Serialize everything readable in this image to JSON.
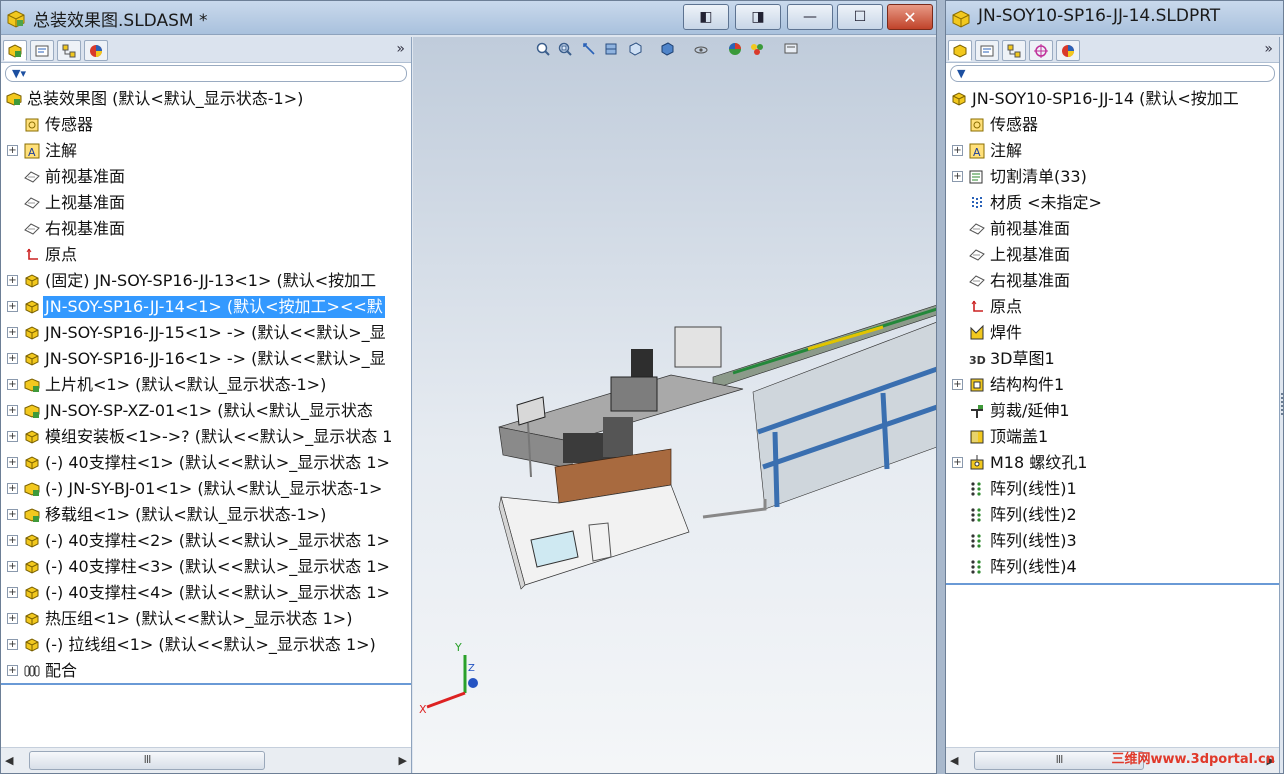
{
  "left_window": {
    "title": "总装效果图.SLDASM *",
    "tree": [
      {
        "label": "总装效果图  (默认<默认_显示状态-1>)",
        "icon": "assembly-icon",
        "level": 0,
        "expander": ""
      },
      {
        "label": "传感器",
        "icon": "sensor-icon",
        "level": 1,
        "expander": ""
      },
      {
        "label": "注解",
        "icon": "annotation-icon",
        "level": 1,
        "expander": "+"
      },
      {
        "label": "前视基准面",
        "icon": "plane-icon",
        "level": 1,
        "expander": ""
      },
      {
        "label": "上视基准面",
        "icon": "plane-icon",
        "level": 1,
        "expander": ""
      },
      {
        "label": "右视基准面",
        "icon": "plane-icon",
        "level": 1,
        "expander": ""
      },
      {
        "label": "原点",
        "icon": "origin-icon",
        "level": 1,
        "expander": ""
      },
      {
        "label": "(固定) JN-SOY-SP16-JJ-13<1> (默认<按加工",
        "icon": "component-icon",
        "level": 1,
        "expander": "+"
      },
      {
        "label": "JN-SOY-SP16-JJ-14<1> (默认<按加工><<默",
        "icon": "component-icon",
        "level": 1,
        "expander": "+",
        "selected": true
      },
      {
        "label": "JN-SOY-SP16-JJ-15<1> -> (默认<<默认>_显",
        "icon": "component-icon",
        "level": 1,
        "expander": "+"
      },
      {
        "label": "JN-SOY-SP16-JJ-16<1> -> (默认<<默认>_显",
        "icon": "component-icon",
        "level": 1,
        "expander": "+"
      },
      {
        "label": "上片机<1> (默认<默认_显示状态-1>)",
        "icon": "subassembly-icon",
        "level": 1,
        "expander": "+"
      },
      {
        "label": "JN-SOY-SP-XZ-01<1> (默认<默认_显示状态",
        "icon": "subassembly-icon",
        "level": 1,
        "expander": "+"
      },
      {
        "label": "模组安装板<1>->? (默认<<默认>_显示状态 1",
        "icon": "component-icon",
        "level": 1,
        "expander": "+"
      },
      {
        "label": "(-) 40支撑柱<1> (默认<<默认>_显示状态 1>",
        "icon": "component-icon",
        "level": 1,
        "expander": "+"
      },
      {
        "label": "(-) JN-SY-BJ-01<1> (默认<默认_显示状态-1>",
        "icon": "subassembly-icon",
        "level": 1,
        "expander": "+"
      },
      {
        "label": "移载组<1> (默认<默认_显示状态-1>)",
        "icon": "subassembly-icon",
        "level": 1,
        "expander": "+"
      },
      {
        "label": "(-) 40支撑柱<2> (默认<<默认>_显示状态 1>",
        "icon": "component-icon",
        "level": 1,
        "expander": "+"
      },
      {
        "label": "(-) 40支撑柱<3> (默认<<默认>_显示状态 1>",
        "icon": "component-icon",
        "level": 1,
        "expander": "+"
      },
      {
        "label": "(-) 40支撑柱<4> (默认<<默认>_显示状态 1>",
        "icon": "component-icon",
        "level": 1,
        "expander": "+"
      },
      {
        "label": "热压组<1> (默认<<默认>_显示状态 1>)",
        "icon": "component-icon",
        "level": 1,
        "expander": "+"
      },
      {
        "label": "(-) 拉线组<1> (默认<<默认>_显示状态 1>)",
        "icon": "component-icon",
        "level": 1,
        "expander": "+"
      },
      {
        "label": "配合",
        "icon": "mates-icon",
        "level": 1,
        "expander": "+"
      }
    ],
    "triad": {
      "y": "Y",
      "z": "Z",
      "x": "X"
    },
    "scroll_grip": "III"
  },
  "right_window": {
    "title": "JN-SOY10-SP16-JJ-14.SLDPRT",
    "tree": [
      {
        "label": "JN-SOY10-SP16-JJ-14  (默认<按加工",
        "icon": "part-icon",
        "level": 0,
        "expander": ""
      },
      {
        "label": "传感器",
        "icon": "sensor-icon",
        "level": 1,
        "expander": ""
      },
      {
        "label": "注解",
        "icon": "annotation-icon",
        "level": 1,
        "expander": "+"
      },
      {
        "label": "切割清单(33)",
        "icon": "cutlist-icon",
        "level": 1,
        "expander": "+"
      },
      {
        "label": "材质 <未指定>",
        "icon": "material-icon",
        "level": 1,
        "expander": ""
      },
      {
        "label": "前视基准面",
        "icon": "plane-icon",
        "level": 1,
        "expander": ""
      },
      {
        "label": "上视基准面",
        "icon": "plane-icon",
        "level": 1,
        "expander": ""
      },
      {
        "label": "右视基准面",
        "icon": "plane-icon",
        "level": 1,
        "expander": ""
      },
      {
        "label": "原点",
        "icon": "origin-icon",
        "level": 1,
        "expander": ""
      },
      {
        "label": "焊件",
        "icon": "weldment-icon",
        "level": 1,
        "expander": ""
      },
      {
        "label": "3D草图1",
        "icon": "sketch3d-icon",
        "level": 1,
        "expander": ""
      },
      {
        "label": "结构构件1",
        "icon": "structure-icon",
        "level": 1,
        "expander": "+"
      },
      {
        "label": "剪裁/延伸1",
        "icon": "trim-icon",
        "level": 1,
        "expander": ""
      },
      {
        "label": "顶端盖1",
        "icon": "endcap-icon",
        "level": 1,
        "expander": ""
      },
      {
        "label": "M18 螺纹孔1",
        "icon": "hole-icon",
        "level": 1,
        "expander": "+"
      },
      {
        "label": "阵列(线性)1",
        "icon": "pattern-icon",
        "level": 1,
        "expander": ""
      },
      {
        "label": "阵列(线性)2",
        "icon": "pattern-icon",
        "level": 1,
        "expander": ""
      },
      {
        "label": "阵列(线性)3",
        "icon": "pattern-icon",
        "level": 1,
        "expander": ""
      },
      {
        "label": "阵列(线性)4",
        "icon": "pattern-icon",
        "level": 1,
        "expander": ""
      }
    ],
    "scroll_grip": "III",
    "watermark": "三维网www.3dportal.cn"
  },
  "colors": {
    "selection": "#3399ff",
    "titlebar": "#b9cde4",
    "close": "#c9442b"
  }
}
